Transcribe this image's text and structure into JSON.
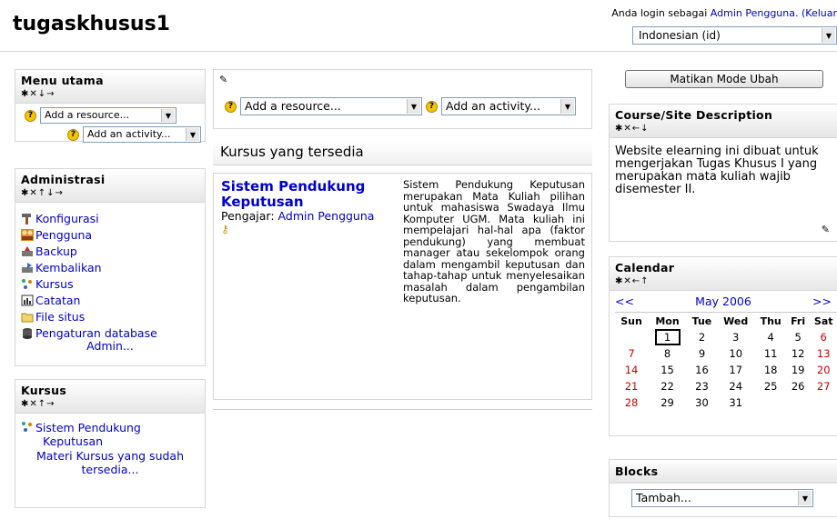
{
  "site": {
    "title": "tugaskhusus1",
    "login_prefix": "Anda login sebagai ",
    "login_user": "Admin Pengguna.",
    "logout_label": " (Keluar",
    "language": "Indonesian (id)"
  },
  "menu_utama": {
    "title": "Menu utama",
    "controls": "✱✕↓→",
    "add_resource": "Add a resource...",
    "add_activity": "Add an activity..."
  },
  "administrasi": {
    "title": "Administrasi",
    "controls": "✱✕↑↓→",
    "items": [
      {
        "label": "Konfigurasi",
        "icon": "hammer-icon"
      },
      {
        "label": "Pengguna",
        "icon": "users-icon"
      },
      {
        "label": "Backup",
        "icon": "backup-icon"
      },
      {
        "label": "Kembalikan",
        "icon": "restore-icon"
      },
      {
        "label": "Kursus",
        "icon": "course-icon"
      },
      {
        "label": "Catatan",
        "icon": "logs-icon"
      },
      {
        "label": "File situs",
        "icon": "folder-icon"
      },
      {
        "label": "Pengaturan database",
        "icon": "database-icon"
      }
    ],
    "db_sub": "Admin..."
  },
  "kursus_block": {
    "title": "Kursus",
    "controls": "✱✕↑→",
    "course_line1": "Sistem Pendukung",
    "course_line2": "Keputusan",
    "more_line1": "Materi Kursus yang sudah",
    "more_line2": "tersedia..."
  },
  "center": {
    "add_resource": "Add a resource...",
    "add_activity": "Add an activity...",
    "available_title": "Kursus yang tersedia",
    "course_title": "Sistem Pendukung Keputusan",
    "teacher_label": "Pengajar: ",
    "teacher_name": "Admin Pengguna",
    "summary": "Sistem Pendukung Keputusan merupakan Mata Kuliah pilihan untuk mahasiswa Swadaya Ilmu Komputer UGM. Mata kuliah ini mempelajari hal-hal apa (faktor pendukung) yang membuat manager atau sekelompok orang dalam mengambil keputusan dan tahap-tahap untuk menyelesaikan masalah dalam pengambilan keputusan."
  },
  "right": {
    "edit_button": "Matikan Mode Ubah",
    "desc_title": "Course/Site Description",
    "desc_controls": "✱✕←↓",
    "desc_text": "Website elearning ini dibuat untuk mengerjakan Tugas Khusus I yang merupakan mata kuliah wajib disemester II.",
    "cal_title": "Calendar",
    "cal_controls": "✱✕←↑",
    "cal_prev": "<<",
    "cal_month": "May 2006",
    "cal_next": ">>",
    "cal_days": [
      "Sun",
      "Mon",
      "Tue",
      "Wed",
      "Thu",
      "Fri",
      "Sat"
    ],
    "cal_weeks": [
      [
        "",
        "1",
        "2",
        "3",
        "4",
        "5",
        "6"
      ],
      [
        "7",
        "8",
        "9",
        "10",
        "11",
        "12",
        "13"
      ],
      [
        "14",
        "15",
        "16",
        "17",
        "18",
        "19",
        "20"
      ],
      [
        "21",
        "22",
        "23",
        "24",
        "25",
        "26",
        "27"
      ],
      [
        "28",
        "29",
        "30",
        "31",
        "",
        "",
        ""
      ]
    ],
    "blocks_title": "Blocks",
    "blocks_select": "Tambah..."
  }
}
